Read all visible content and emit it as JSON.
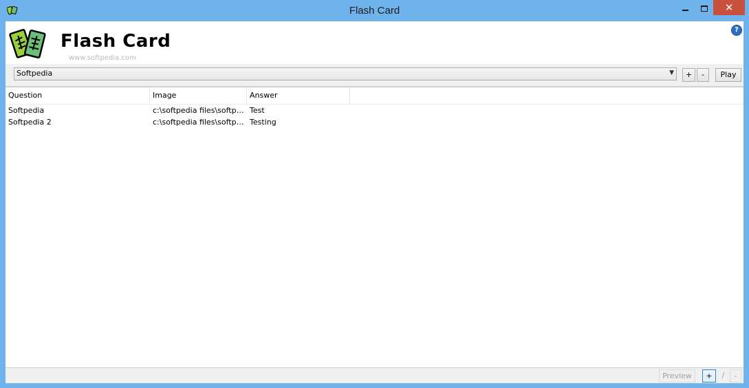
{
  "window": {
    "title": "Flash Card",
    "minimize_label": "",
    "maximize_label": "",
    "close_label": "✕"
  },
  "header": {
    "app_title": "Flash Card",
    "watermark": "www.softpedia.com",
    "help_label": "?"
  },
  "toolbar": {
    "deck_selected": "Softpedia",
    "add_deck_label": "+",
    "remove_deck_label": "-",
    "play_label": "Play"
  },
  "list": {
    "columns": [
      "Question",
      "Image",
      "Answer"
    ],
    "rows": [
      {
        "question": "Softpedia",
        "image": "c:\\softpedia files\\softpe...",
        "answer": "Test"
      },
      {
        "question": "Softpedia 2",
        "image": "c:\\softpedia files\\softpe...",
        "answer": "Testing"
      }
    ]
  },
  "statusbar": {
    "preview_label": "Preview",
    "add_card_label": "+",
    "edit_card_label": "/",
    "remove_card_label": "-"
  },
  "colors": {
    "titlebar": "#6fb3ec",
    "close_button": "#c7503f",
    "toolbar_bg": "#f0f0f0"
  }
}
